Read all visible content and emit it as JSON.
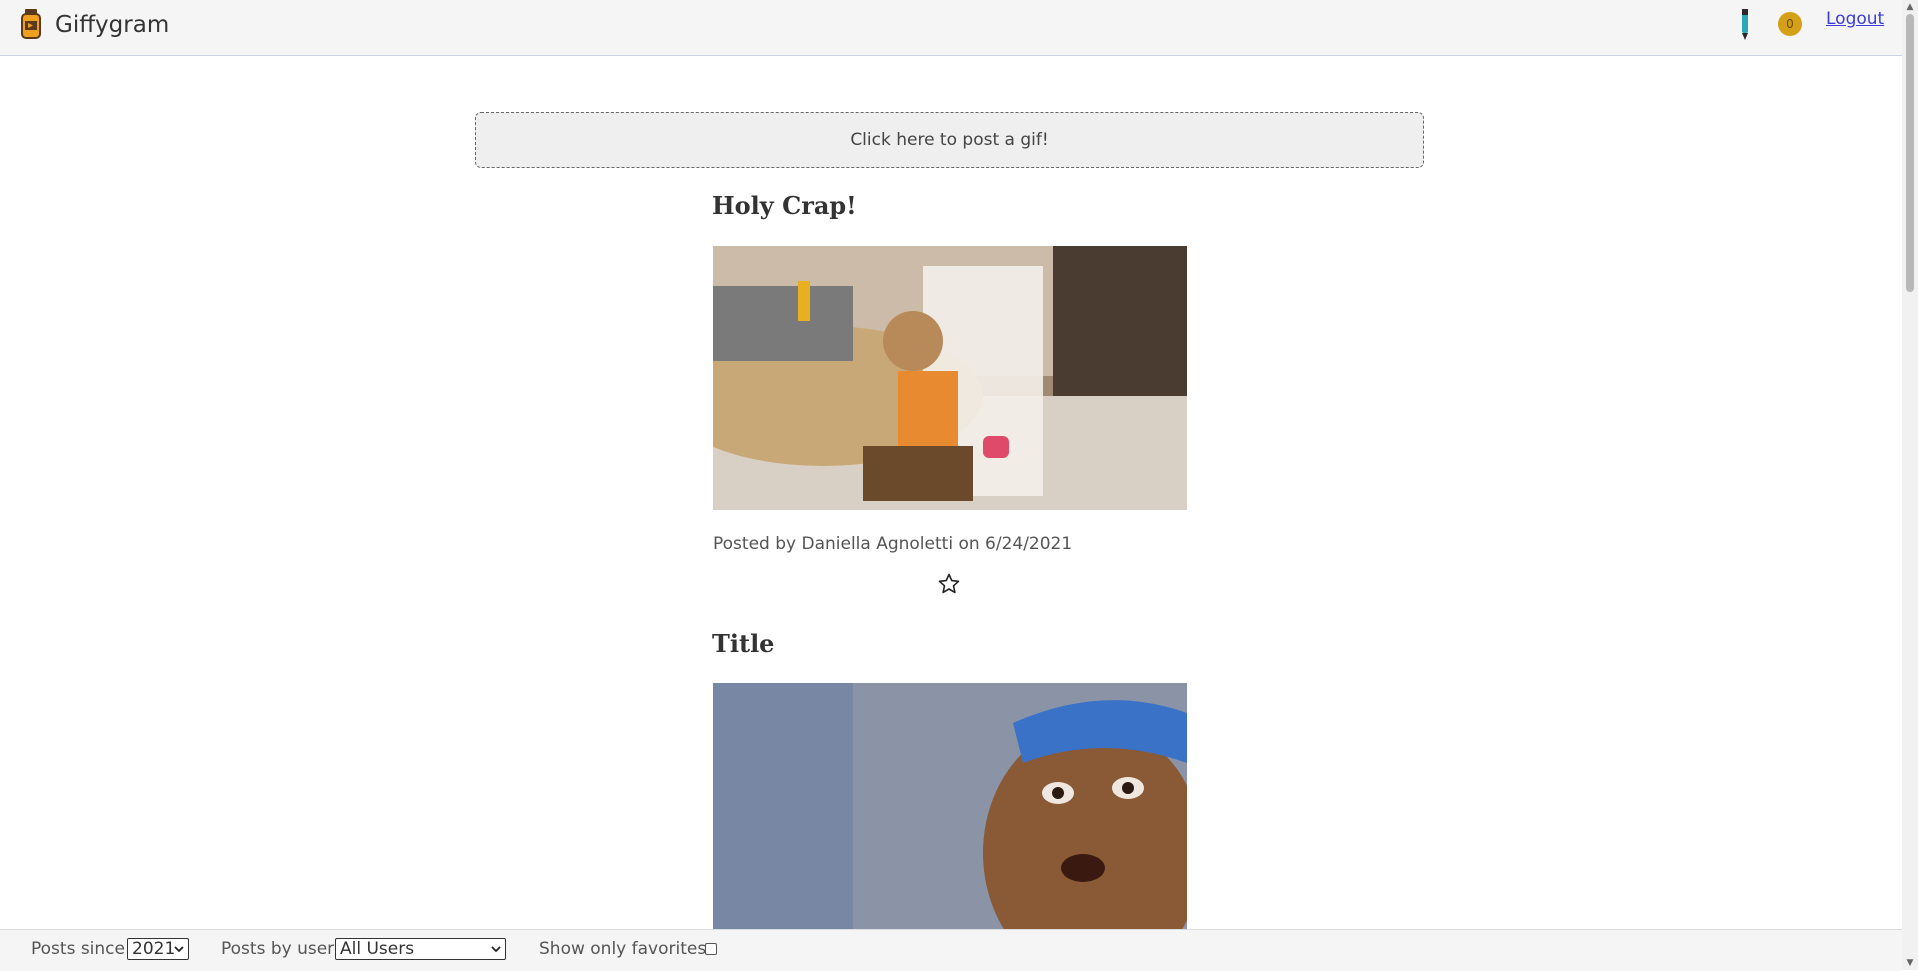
{
  "header": {
    "app_title": "Giffygram",
    "logo_icon": "jar-icon",
    "pen_icon": "pen-icon",
    "notification_count": "0",
    "logout_label": "Logout"
  },
  "composer": {
    "prompt": "Click here to post a gif!"
  },
  "posts": [
    {
      "title": "Holy Crap!",
      "meta": "Posted by Daniella Agnoletti on 6/24/2021",
      "image_icon": "gif-image",
      "favorite_icon": "star-outline-icon"
    },
    {
      "title": "Title",
      "image_icon": "gif-image"
    }
  ],
  "footer": {
    "since_label": "Posts since",
    "since_value": "2021",
    "user_label": "Posts by user",
    "user_value": "All Users",
    "favorites_label": "Show only favorites",
    "favorites_checked": false
  },
  "colors": {
    "accent_link": "#3b3bd8",
    "badge": "#d4a017"
  }
}
